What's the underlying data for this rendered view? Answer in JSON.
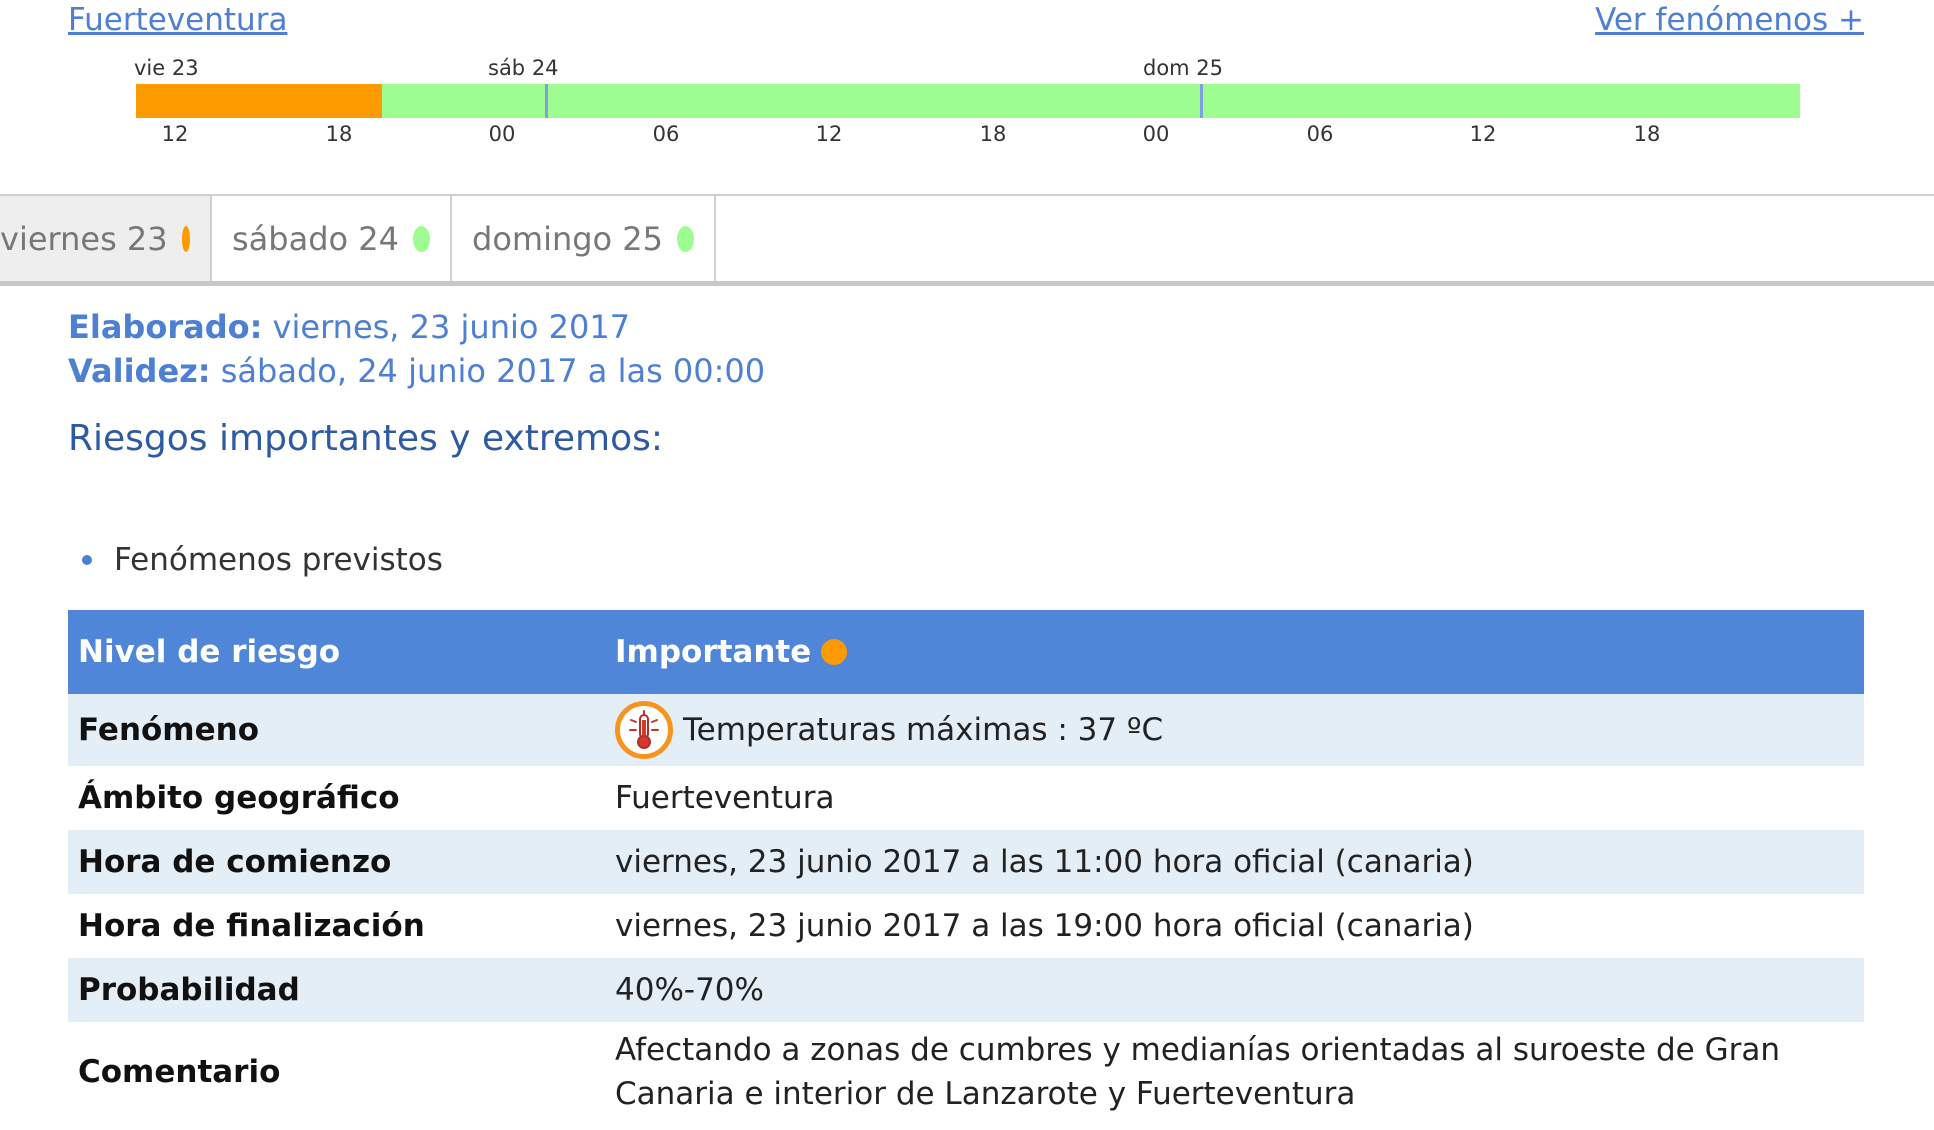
{
  "header": {
    "region_link": "Fuerteventura",
    "more_link": "Ver fenómenos +"
  },
  "timeline": {
    "days": [
      "vie 23",
      "sáb 24",
      "dom 25"
    ],
    "hours": [
      "12",
      "18",
      "00",
      "06",
      "12",
      "18",
      "00",
      "06",
      "12",
      "18"
    ],
    "segments": [
      {
        "level": "importante",
        "color": "#fd9a00",
        "from_hour": 9,
        "to_hour": 18
      },
      {
        "level": "sin riesgo",
        "color": "#9dfd90",
        "from_hour": 18,
        "to_hour": 70
      }
    ]
  },
  "tabs": [
    {
      "label": "viernes 23",
      "color": "#fd9a00"
    },
    {
      "label": "sábado 24",
      "color": "#9dfd90"
    },
    {
      "label": "domingo 25",
      "color": "#9dfd90"
    }
  ],
  "info": {
    "elaborado_label": "Elaborado:",
    "elaborado_value": " viernes, 23 junio 2017",
    "validez_label": "Validez:",
    "validez_value": " sábado, 24 junio 2017 a las 00:00"
  },
  "section": {
    "title": "Riesgos importantes y extremos:",
    "bullet": "Fenómenos previstos"
  },
  "table": {
    "nivel_label": "Nivel de riesgo",
    "nivel_value": "Importante",
    "nivel_color": "#fd9a00",
    "fenomeno_label": "Fenómeno",
    "fenomeno_icon": "thermometer-icon",
    "fenomeno_value": "Temperaturas máximas : 37 ºC",
    "ambito_label": "Ámbito geográfico",
    "ambito_value": "Fuerteventura",
    "comienzo_label": "Hora de comienzo",
    "comienzo_value": "viernes, 23 junio 2017 a las 11:00 hora oficial (canaria)",
    "fin_label": "Hora de finalización",
    "fin_value": "viernes, 23 junio 2017 a las 19:00 hora oficial (canaria)",
    "prob_label": "Probabilidad",
    "prob_value": "40%-70%",
    "comentario_label": "Comentario",
    "comentario_value": "Afectando a zonas de cumbres y medianías orientadas al suroeste de Gran Canaria e interior de Lanzarote y Fuerteventura"
  }
}
